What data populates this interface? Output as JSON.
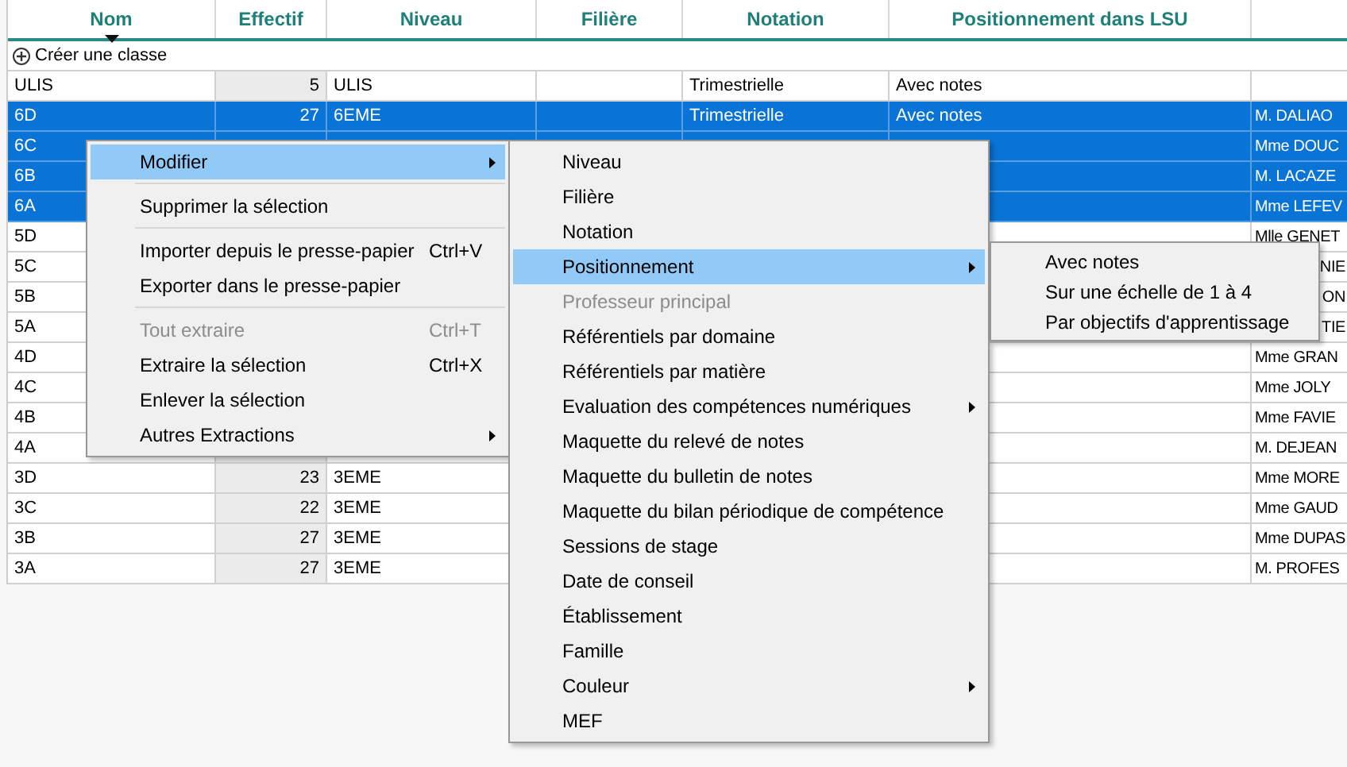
{
  "columns": [
    {
      "label": "Nom",
      "sorted": true
    },
    {
      "label": "Effectif",
      "sorted": false
    },
    {
      "label": "Niveau",
      "sorted": false
    },
    {
      "label": "Filière",
      "sorted": false
    },
    {
      "label": "Notation",
      "sorted": false
    },
    {
      "label": "Positionnement dans LSU",
      "sorted": false
    }
  ],
  "create_label": "Créer une classe",
  "rows": [
    {
      "selected": false,
      "nom": "ULIS",
      "effectif": "5",
      "niveau": "ULIS",
      "notation": "Trimestrielle",
      "positionnement": "Avec notes"
    },
    {
      "selected": true,
      "nom": "6D",
      "effectif": "27",
      "niveau": "6EME",
      "notation": "Trimestrielle",
      "positionnement": "Avec notes",
      "column_7": "M. DALIAO"
    },
    {
      "selected": true,
      "nom": "6C",
      "column_7": "Mme DOUC"
    },
    {
      "selected": true,
      "nom": "6B",
      "column_7": "M. LACAZE"
    },
    {
      "selected": true,
      "nom": "6A",
      "column_7": "Mme LEFEV"
    },
    {
      "selected": false,
      "nom": "5D",
      "column_7": "Mlle GENET"
    },
    {
      "selected": false,
      "nom": "5C",
      "column_7": "NIE",
      "cut_left": true
    },
    {
      "selected": false,
      "nom": "5B",
      "column_7": "ON",
      "cut_left": true
    },
    {
      "selected": false,
      "nom": "5A",
      "column_7": "TIE",
      "cut_left": true
    },
    {
      "selected": false,
      "nom": "4D",
      "column_7": "Mme GRAN"
    },
    {
      "selected": false,
      "nom": "4C",
      "column_7": "Mme JOLY"
    },
    {
      "selected": false,
      "nom": "4B",
      "column_7": "Mme FAVIE"
    },
    {
      "selected": false,
      "nom": "4A",
      "column_7": "M. DEJEAN"
    },
    {
      "selected": false,
      "nom": "3D",
      "effectif": "23",
      "niveau": "3EME",
      "column_7": "Mme MORE"
    },
    {
      "selected": false,
      "nom": "3C",
      "effectif": "22",
      "niveau": "3EME",
      "column_7": "Mme GAUD"
    },
    {
      "selected": false,
      "nom": "3B",
      "effectif": "27",
      "niveau": "3EME",
      "column_7": "Mme DUPAS"
    },
    {
      "selected": false,
      "nom": "3A",
      "effectif": "27",
      "niveau": "3EME",
      "column_7": "M. PROFES"
    }
  ],
  "context_menu": [
    {
      "kind": "item",
      "label": "Modifier",
      "highlighted": true,
      "disabled": false,
      "submenu": true
    },
    {
      "kind": "separator"
    },
    {
      "kind": "item",
      "label": "Supprimer la sélection",
      "highlighted": false,
      "disabled": false,
      "submenu": false
    },
    {
      "kind": "separator"
    },
    {
      "kind": "item",
      "label": "Importer depuis le presse-papier",
      "shortcut": "Ctrl+V",
      "highlighted": false,
      "disabled": false,
      "submenu": false
    },
    {
      "kind": "item",
      "label": "Exporter dans le presse-papier",
      "highlighted": false,
      "disabled": false,
      "submenu": false
    },
    {
      "kind": "separator"
    },
    {
      "kind": "item",
      "label": "Tout extraire",
      "shortcut": "Ctrl+T",
      "highlighted": false,
      "disabled": true,
      "submenu": false
    },
    {
      "kind": "item",
      "label": "Extraire la sélection",
      "shortcut": "Ctrl+X",
      "highlighted": false,
      "disabled": false,
      "submenu": false
    },
    {
      "kind": "item",
      "label": "Enlever la sélection",
      "highlighted": false,
      "disabled": false,
      "submenu": false
    },
    {
      "kind": "item",
      "label": "Autres Extractions",
      "highlighted": false,
      "disabled": false,
      "submenu": true
    }
  ],
  "modifier_submenu": [
    {
      "kind": "item",
      "label": "Niveau",
      "highlighted": false,
      "disabled": false,
      "submenu": false
    },
    {
      "kind": "item",
      "label": "Filière",
      "highlighted": false,
      "disabled": false,
      "submenu": false
    },
    {
      "kind": "item",
      "label": "Notation",
      "highlighted": false,
      "disabled": false,
      "submenu": false
    },
    {
      "kind": "item",
      "label": "Positionnement",
      "highlighted": true,
      "disabled": false,
      "submenu": true
    },
    {
      "kind": "item",
      "label": "Professeur principal",
      "highlighted": false,
      "disabled": true,
      "submenu": false
    },
    {
      "kind": "item",
      "label": "Référentiels par domaine",
      "highlighted": false,
      "disabled": false,
      "submenu": false
    },
    {
      "kind": "item",
      "label": "Référentiels par matière",
      "highlighted": false,
      "disabled": false,
      "submenu": false
    },
    {
      "kind": "item",
      "label": "Evaluation des compétences numériques",
      "highlighted": false,
      "disabled": false,
      "submenu": true
    },
    {
      "kind": "item",
      "label": "Maquette du relevé de notes",
      "highlighted": false,
      "disabled": false,
      "submenu": false
    },
    {
      "kind": "item",
      "label": "Maquette du bulletin de notes",
      "highlighted": false,
      "disabled": false,
      "submenu": false
    },
    {
      "kind": "item",
      "label": "Maquette du bilan périodique de compétence",
      "highlighted": false,
      "disabled": false,
      "submenu": false
    },
    {
      "kind": "item",
      "label": "Sessions de stage",
      "highlighted": false,
      "disabled": false,
      "submenu": false
    },
    {
      "kind": "item",
      "label": "Date de conseil",
      "highlighted": false,
      "disabled": false,
      "submenu": false
    },
    {
      "kind": "item",
      "label": "Établissement",
      "highlighted": false,
      "disabled": false,
      "submenu": false
    },
    {
      "kind": "item",
      "label": "Famille",
      "highlighted": false,
      "disabled": false,
      "submenu": false
    },
    {
      "kind": "item",
      "label": "Couleur",
      "highlighted": false,
      "disabled": false,
      "submenu": true
    },
    {
      "kind": "item",
      "label": "MEF",
      "highlighted": false,
      "disabled": false,
      "submenu": false
    }
  ],
  "positionnement_submenu": [
    {
      "kind": "item",
      "label": "Avec notes",
      "highlighted": false,
      "disabled": false,
      "submenu": false
    },
    {
      "kind": "item",
      "label": "Sur une échelle de 1 à 4",
      "highlighted": false,
      "disabled": false,
      "submenu": false
    },
    {
      "kind": "item",
      "label": "Par objectifs d'apprentissage",
      "highlighted": false,
      "disabled": false,
      "submenu": false
    }
  ]
}
